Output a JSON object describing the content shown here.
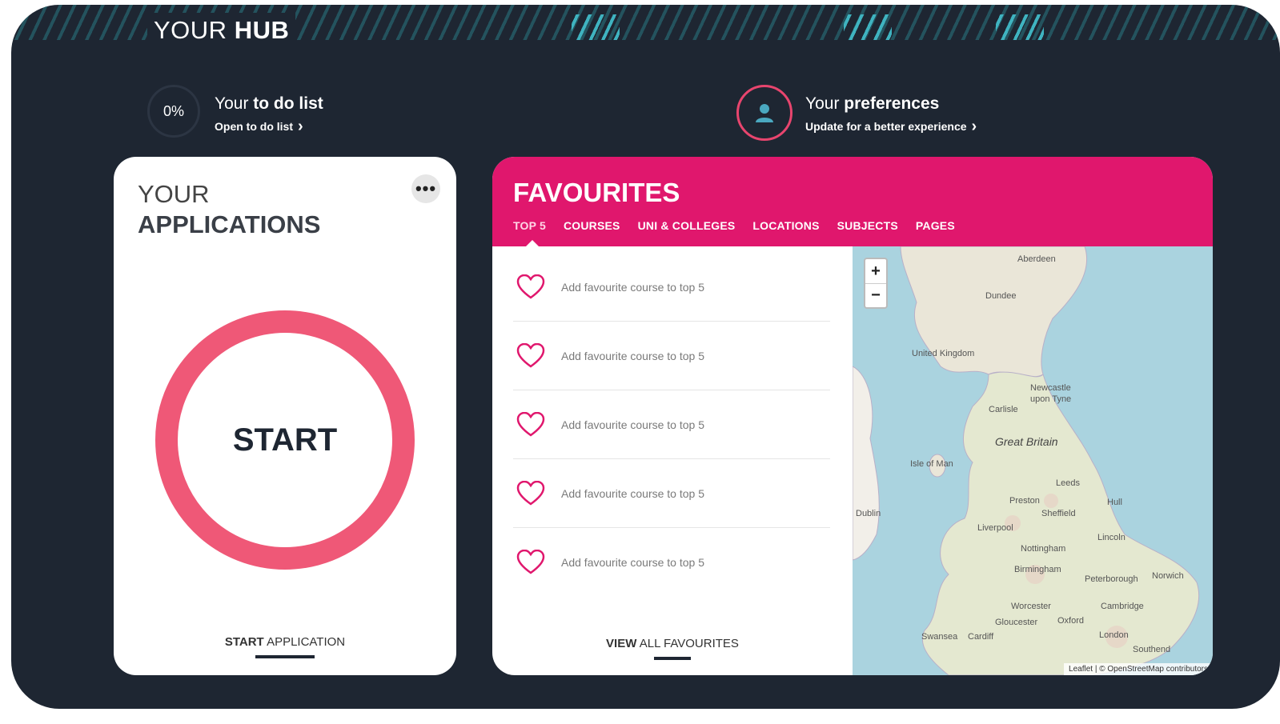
{
  "hub": {
    "title_regular": "YOUR",
    "title_bold": "HUB"
  },
  "todo": {
    "percent": "0%",
    "line_regular": "Your",
    "line_bold": "to do list",
    "link": "Open to do list",
    "chevron": "›"
  },
  "preferences": {
    "line_regular": "Your",
    "line_bold": "preferences",
    "link": "Update for a better experience",
    "chevron": "›",
    "icon": "user-icon"
  },
  "applications": {
    "title_line1": "YOUR",
    "title_line2": "APPLICATIONS",
    "menu": "•••",
    "progress_label": "START",
    "link_bold": "START",
    "link_regular": "APPLICATION",
    "accent_color": "#ef5877"
  },
  "favourites": {
    "title": "FAVOURITES",
    "header_color": "#e0176d",
    "tabs": [
      "TOP 5",
      "COURSES",
      "UNI & COLLEGES",
      "LOCATIONS",
      "SUBJECTS",
      "PAGES"
    ],
    "active_tab": "TOP 5",
    "items": [
      "Add favourite course to top 5",
      "Add favourite course to top 5",
      "Add favourite course to top 5",
      "Add favourite course to top 5",
      "Add favourite course to top 5"
    ],
    "view_all_bold": "VIEW",
    "view_all_regular": "ALL FAVOURITES"
  },
  "map": {
    "zoom_in": "+",
    "zoom_out": "−",
    "labels": {
      "aberdeen": "Aberdeen",
      "dundee": "Dundee",
      "united_kingdom": "United Kingdom",
      "newcastle": "Newcastle upon Tyne",
      "carlisle": "Carlisle",
      "great_britain": "Great Britain",
      "isle_of_man": "Isle of Man",
      "leeds": "Leeds",
      "preston": "Preston",
      "hull": "Hull",
      "dublin": "Dublin",
      "sheffield": "Sheffield",
      "liverpool": "Liverpool",
      "lincoln": "Lincoln",
      "nottingham": "Nottingham",
      "birmingham": "Birmingham",
      "peterborough": "Peterborough",
      "norwich": "Norwich",
      "worcester": "Worcester",
      "cambridge": "Cambridge",
      "gloucester": "Gloucester",
      "oxford": "Oxford",
      "swansea": "Swansea",
      "cardiff": "Cardiff",
      "london": "London",
      "southend": "Southend"
    },
    "attribution": "Leaflet | © OpenStreetMap contributors"
  }
}
